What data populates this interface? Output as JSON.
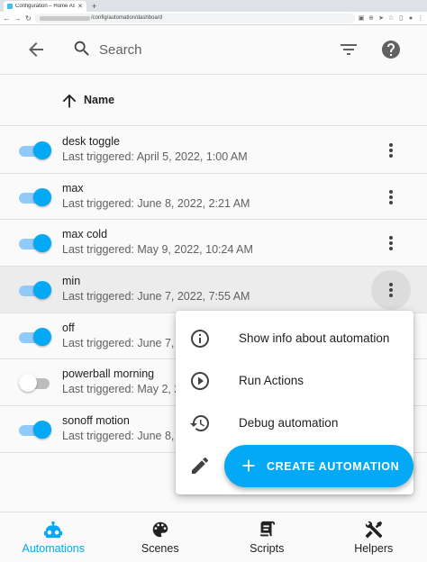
{
  "browser": {
    "tab_title": "Configuration – Home Ass",
    "url_path": "/config/automation/dashboard"
  },
  "header": {
    "search_placeholder": "Search"
  },
  "table": {
    "sort_column": "Name"
  },
  "automations": [
    {
      "name": "desk toggle",
      "last_triggered": "Last triggered: April 5, 2022, 1:00 AM",
      "enabled": true
    },
    {
      "name": "max",
      "last_triggered": "Last triggered: June 8, 2022, 2:21 AM",
      "enabled": true
    },
    {
      "name": "max cold",
      "last_triggered": "Last triggered: May 9, 2022, 10:24 AM",
      "enabled": true
    },
    {
      "name": "min",
      "last_triggered": "Last triggered: June 7, 2022, 7:55 AM",
      "enabled": true
    },
    {
      "name": "off",
      "last_triggered": "Last triggered: June 7,",
      "enabled": true
    },
    {
      "name": "powerball morning",
      "last_triggered": "Last triggered: May 2, 2",
      "enabled": false
    },
    {
      "name": "sonoff motion",
      "last_triggered": "Last triggered: June 8,",
      "enabled": true
    }
  ],
  "menu": {
    "items": [
      {
        "label": "Show info about automation",
        "icon": "info-icon"
      },
      {
        "label": "Run Actions",
        "icon": "play-circle-icon"
      },
      {
        "label": "Debug automation",
        "icon": "history-icon"
      },
      {
        "label": "",
        "icon": "pencil-icon"
      }
    ]
  },
  "fab": {
    "label": "CREATE AUTOMATION"
  },
  "bottom_nav": {
    "items": [
      {
        "label": "Automations",
        "icon": "robot-icon",
        "active": true
      },
      {
        "label": "Scenes",
        "icon": "palette-icon",
        "active": false
      },
      {
        "label": "Scripts",
        "icon": "script-icon",
        "active": false
      },
      {
        "label": "Helpers",
        "icon": "tools-icon",
        "active": false
      }
    ]
  },
  "colors": {
    "accent": "#03a9f4",
    "toggle_track": "#90caf9",
    "text_primary": "#212121",
    "text_secondary": "#616161"
  }
}
